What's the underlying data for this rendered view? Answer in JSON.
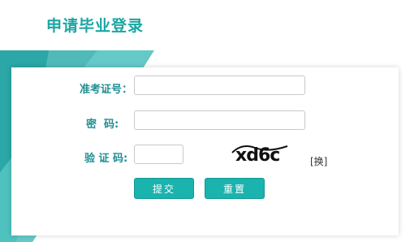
{
  "page": {
    "title": "申请毕业登录"
  },
  "form": {
    "exam_id_label": "准考证号：",
    "password_label": "密  码:",
    "captcha_label": "验 证 码:",
    "exam_id_value": "",
    "password_value": "",
    "captcha_value": "",
    "captcha_text": "xd6c",
    "swap_label": "[换]",
    "submit_label": "提交",
    "reset_label": "重置"
  },
  "colors": {
    "accent": "#1aa6a3",
    "label": "#1f8e93",
    "button": "#1ab3ae"
  }
}
